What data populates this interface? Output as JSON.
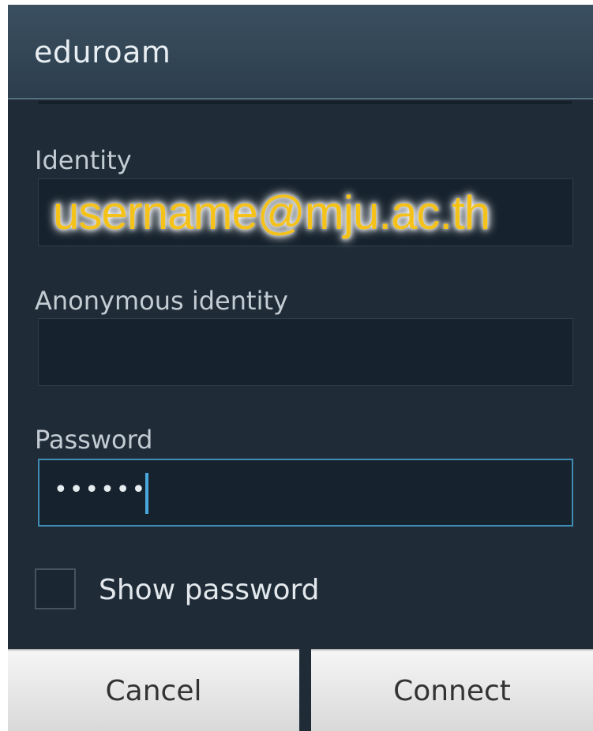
{
  "dialog": {
    "title": "eduroam",
    "fields": [
      {
        "label": "Identity",
        "value": "username@mju.ac.th"
      },
      {
        "label": "Anonymous identity",
        "value": ""
      },
      {
        "label": "Password",
        "value": "••••••"
      }
    ],
    "show_password": {
      "label": "Show password",
      "checked": false
    },
    "buttons": {
      "cancel": "Cancel",
      "connect": "Connect"
    }
  }
}
